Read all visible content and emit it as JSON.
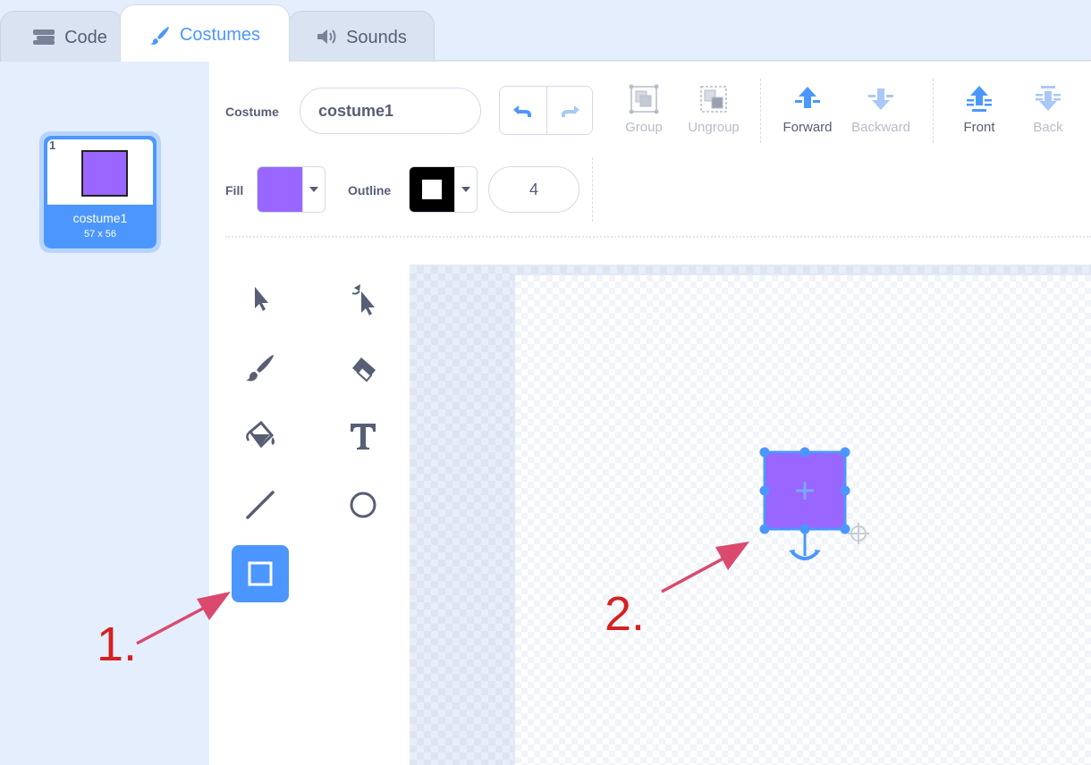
{
  "tabs": [
    {
      "label": "Code",
      "icon": "code-blocks-icon"
    },
    {
      "label": "Costumes",
      "icon": "paintbrush-icon",
      "active": true
    },
    {
      "label": "Sounds",
      "icon": "speaker-icon"
    }
  ],
  "costume_list": {
    "items": [
      {
        "number": "1",
        "name": "costume1",
        "size": "57 x 56",
        "selected": true
      }
    ]
  },
  "toolbar": {
    "costume_label": "Costume",
    "costume_name": "costume1",
    "group": "Group",
    "ungroup": "Ungroup",
    "forward": "Forward",
    "backward": "Backward",
    "front": "Front",
    "back": "Back",
    "fill_label": "Fill",
    "fill_color": "#9966ff",
    "outline_label": "Outline",
    "outline_color": "#000000",
    "outline_width": "4"
  },
  "tools": [
    {
      "name": "select-tool",
      "icon": "arrow-cursor-icon"
    },
    {
      "name": "reshape-tool",
      "icon": "reshape-cursor-icon"
    },
    {
      "name": "brush-tool",
      "icon": "brush-icon"
    },
    {
      "name": "eraser-tool",
      "icon": "eraser-icon"
    },
    {
      "name": "fill-tool",
      "icon": "paint-bucket-icon"
    },
    {
      "name": "text-tool",
      "icon": "text-icon"
    },
    {
      "name": "line-tool",
      "icon": "line-icon"
    },
    {
      "name": "circle-tool",
      "icon": "circle-icon"
    },
    {
      "name": "rectangle-tool",
      "icon": "rectangle-icon",
      "selected": true
    }
  ],
  "annotations": {
    "step1": "1.",
    "step2": "2.",
    "color": "#d94a6e"
  },
  "colors": {
    "accent": "#4c97ff",
    "shape_fill": "#9966ff",
    "selection": "#4c97ff"
  }
}
